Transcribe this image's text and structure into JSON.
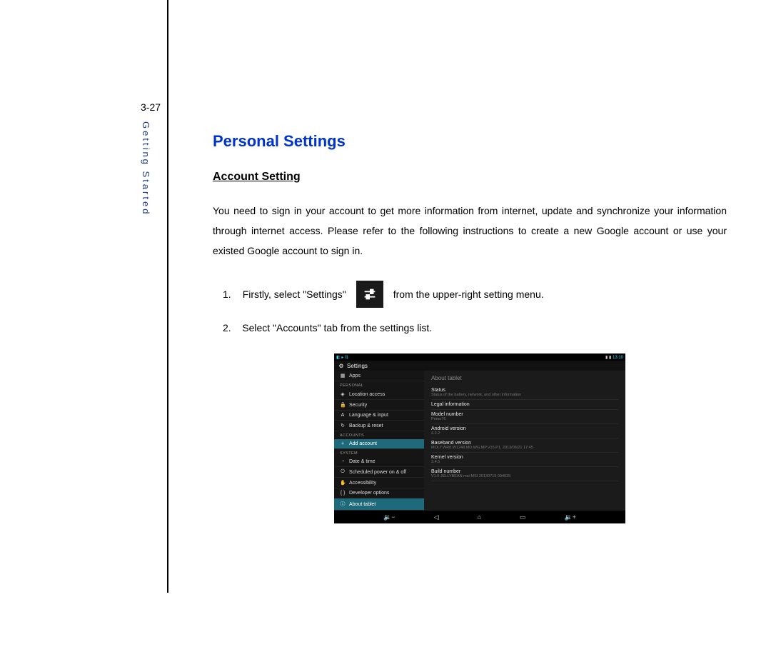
{
  "page_number": "3-27",
  "sidebar_text": "Getting Started",
  "headings": {
    "personal": "Personal Settings",
    "account": "Account Setting"
  },
  "paragraph": "You need to sign in your account to get more information from internet, update and synchronize your information through internet access. Please refer to the following instructions to create a new Google account or use your existed Google account to sign in.",
  "steps": {
    "one_num": "1.",
    "one_a": "Firstly, select \"Settings\"",
    "one_b": "from the upper-right setting menu.",
    "two_num": "2.",
    "two": "Select \"Accounts\" tab from the settings list."
  },
  "tablet": {
    "time": "13:10",
    "header": "Settings",
    "about_title": "About tablet",
    "left_categories": {
      "personal": "PERSONAL",
      "accounts": "ACCOUNTS",
      "system": "SYSTEM"
    },
    "left_items": {
      "apps": "Apps",
      "location": "Location access",
      "security": "Security",
      "language": "Language & input",
      "backup": "Backup & reset",
      "add_account": "Add account",
      "date": "Date & time",
      "power": "Scheduled power on & off",
      "accessibility": "Accessibility",
      "developer": "Developer options",
      "about": "About tablet"
    },
    "right": {
      "status_lbl": "Status",
      "status_sub": "Status of the battery, network, and other information",
      "legal": "Legal information",
      "model_lbl": "Model number",
      "model_sub": "Primo76",
      "android_lbl": "Android version",
      "android_sub": "4.2.2",
      "baseband_lbl": "Baseband version",
      "baseband_sub": "MOLY.WR8.W1248.MD.WG.MP.V16.P1, 2013/06/21 17:45",
      "kernel_lbl": "Kernel version",
      "kernel_sub": "3.4.5",
      "build_lbl": "Build number",
      "build_sub": "V1.0 JELLYBEAN msi-MSI 20130719 094039"
    }
  }
}
